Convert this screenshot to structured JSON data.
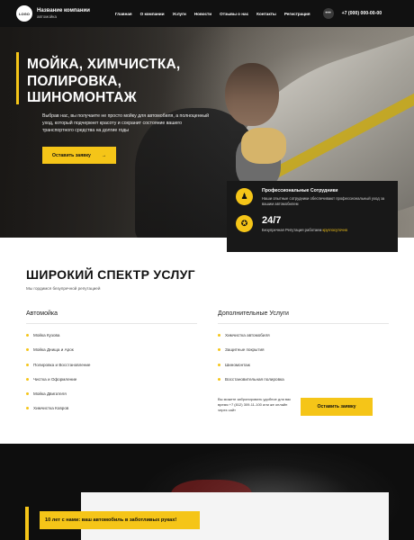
{
  "header": {
    "logo_text": "LOGO",
    "company_name": "Название компании",
    "company_sub": "автомойка",
    "nav": [
      "Главная",
      "О компании",
      "Услуги",
      "Новости",
      "Отзывы о нас",
      "Контакты",
      "Регистрация"
    ],
    "menu_dots": "•••",
    "phone": "+7 (000) 000-00-00"
  },
  "hero": {
    "title": "Мойка, химчистка, полировка, шиномонтаж",
    "text": "Выбрав нас, вы получаете не просто мойку для автомобиля, а полноценный уход, который подчеркнет красоту и сохранит состояние вашего транспортного средства на долгие годы",
    "button": "Оставить заявку",
    "button_arrow": "→"
  },
  "features": [
    {
      "icon": "♟",
      "title": "Профессиональные Сотрудники",
      "desc": "Наши опытные сотрудники обеспечивают профессиональный уход за вашим автомобилем"
    },
    {
      "icon": "✪",
      "big": "24/7",
      "desc_prefix": "Безупречная Репутация работаем ",
      "desc_accent": "круглосуточно"
    }
  ],
  "services": {
    "title": "Широкий спектр услуг",
    "subtitle": "Мы гордимся безупречной репутацией",
    "col1_title": "Автомойка",
    "col1_items": [
      "Мойка Кузова",
      "Мойка Днища и Арок",
      "Полировка и Восстановление",
      "Чистка и Оформление",
      "Мойка Двигателя",
      "Химчистка Ковров"
    ],
    "col2_title": "Дополнительные Услуги",
    "col2_items": [
      "Химчистка автомобиля",
      "Защитные покрытия",
      "Шиномонтаж",
      "Восстановительная полировка"
    ],
    "book_text": "Вы можете забронировать удобное для вас время +7 (812) 309-11-100 или же онлайн через сайт",
    "book_button": "Оставить заявку"
  },
  "bottom": {
    "banner": "10 лет с нами: ваш автомобиль в заботливых руках!"
  },
  "colors": {
    "accent": "#f5c518",
    "dark": "#111111"
  }
}
